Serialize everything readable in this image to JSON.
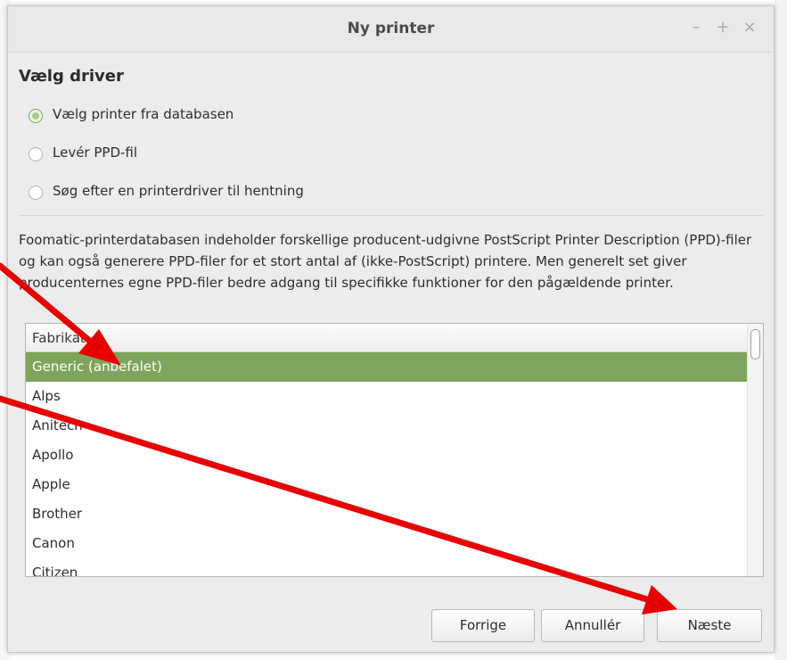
{
  "window": {
    "title": "Ny printer",
    "controls": {
      "minimize": "–",
      "maximize": "+",
      "close": "×"
    }
  },
  "section_heading": "Vælg driver",
  "options": [
    {
      "label": "Vælg printer fra databasen",
      "checked": true
    },
    {
      "label": "Levér PPD-fil",
      "checked": false
    },
    {
      "label": "Søg efter en printerdriver til hentning",
      "checked": false
    }
  ],
  "description": "Foomatic-printerdatabasen indeholder forskellige producent-udgivne PostScript Printer Description (PPD)-filer og kan også generere PPD-filer for et stort antal af (ikke-PostScript) printere. Men generelt set giver producenternes egne PPD-filer bedre adgang til specifikke funktioner for den pågældende printer.",
  "list": {
    "header": "Fabrikat",
    "rows": [
      {
        "label": "Generic (anbefalet)",
        "selected": true
      },
      {
        "label": "Alps",
        "selected": false
      },
      {
        "label": "Anitech",
        "selected": false
      },
      {
        "label": "Apollo",
        "selected": false
      },
      {
        "label": "Apple",
        "selected": false
      },
      {
        "label": "Brother",
        "selected": false
      },
      {
        "label": "Canon",
        "selected": false
      },
      {
        "label": "Citizen",
        "selected": false
      }
    ]
  },
  "buttons": {
    "back": "Forrige",
    "cancel": "Annullér",
    "next": "Næste"
  },
  "colors": {
    "selection": "#7ea55b",
    "annotation_arrow": "#e60000"
  }
}
